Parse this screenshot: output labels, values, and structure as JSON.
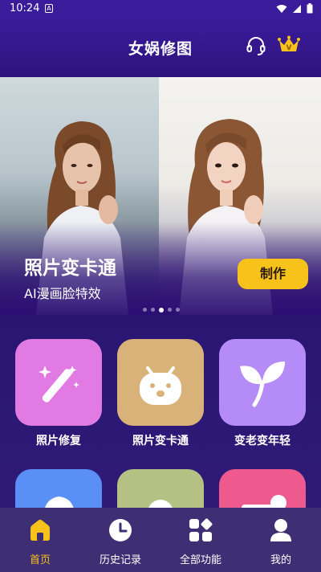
{
  "status_bar": {
    "time": "10:24",
    "notification_icon": "A"
  },
  "header": {
    "title": "女娲修图",
    "icons": [
      "headset-icon",
      "crown-vip-icon"
    ],
    "crown_letter": "V"
  },
  "banner": {
    "title": "照片变卡通",
    "subtitle": "AI漫画脸特效",
    "button_label": "制作",
    "slide_count": 5,
    "active_slide": 3
  },
  "features": [
    {
      "label": "照片修复",
      "icon": "magic-wand-icon",
      "color": "#e27ae4"
    },
    {
      "label": "照片变卡通",
      "icon": "cartoon-face-icon",
      "color": "#d9b27a"
    },
    {
      "label": "变老变年轻",
      "icon": "sprout-icon",
      "color": "#b58bf7"
    }
  ],
  "features_row2": [
    {
      "icon": "portrait-icon",
      "color": "#5a8ff5"
    },
    {
      "icon": "person-icon",
      "color": "#b5c184"
    },
    {
      "icon": "photo-edit-icon",
      "color": "#ee5a8e"
    }
  ],
  "nav": [
    {
      "label": "首页",
      "icon": "home-icon",
      "active": true
    },
    {
      "label": "历史记录",
      "icon": "clock-icon",
      "active": false
    },
    {
      "label": "全部功能",
      "icon": "grid-icon",
      "active": false
    },
    {
      "label": "我的",
      "icon": "user-icon",
      "active": false
    }
  ],
  "colors": {
    "accent": "#f7c21a",
    "background": "#2a0f6e",
    "nav_bg": "#3e2f74"
  }
}
